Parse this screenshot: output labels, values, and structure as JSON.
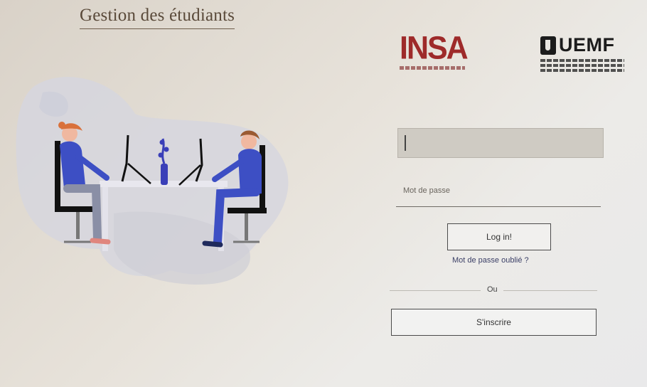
{
  "header": {
    "title": "Gestion des étudiants"
  },
  "logos": {
    "insa": {
      "text": "INSA",
      "color": "#9e2a2a"
    },
    "uemf": {
      "text": "UEMF",
      "color": "#1c1c1c"
    }
  },
  "login": {
    "username_value": "",
    "password_placeholder": "Mot de passe",
    "login_button": "Log in!",
    "forgot_link": "Mot de passe oublié ?",
    "separator": "Ou",
    "register_button": "S'inscrire"
  },
  "illustration": {
    "name": "two-students-at-desk-illustration",
    "accent_color": "#3d4fc4"
  }
}
